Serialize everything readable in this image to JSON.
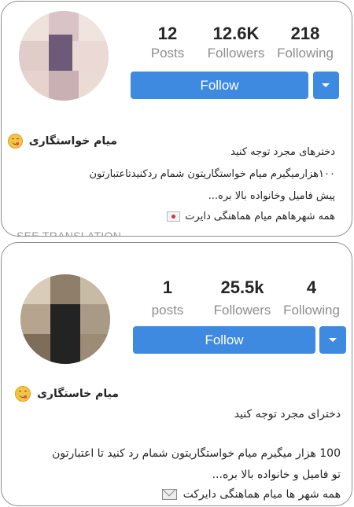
{
  "profile1": {
    "stats": {
      "posts_value": "12",
      "posts_label": "Posts",
      "followers_value": "12.6K",
      "followers_label": "Followers",
      "following_value": "218",
      "following_label": "Following"
    },
    "follow_label": "Follow",
    "name": "میام خواستگاری",
    "bio": [
      "دخترهای مجرد توجه کنید",
      "۱۰۰هزارمیگیرم میام خواستگاریتون شمام ردکنیدتاعتبارتون",
      "پیش فامیل وخانواده بالا بره...",
      "همه شهرهاهم میام هماهنگی دایرت"
    ],
    "see_translation": "SEE TRANSLATION"
  },
  "profile2": {
    "stats": {
      "posts_value": "1",
      "posts_label": "posts",
      "followers_value": "25.5k",
      "followers_label": "Followers",
      "following_value": "4",
      "following_label": "Following"
    },
    "follow_label": "Follow",
    "name": "میام خاستگاری",
    "bio": [
      "دخترای مجرد توجه کنید",
      "100 هزار میگیرم میام خواستگاریتون شمام رد کنید تا اعتبارتون",
      "تو فامیل و خانواده بالا بره...",
      "همه شهر ها میام هماهنگی دایرکت"
    ]
  },
  "colors": {
    "follow_blue": "#3d8ae0",
    "label_gray": "#8e8e8e"
  },
  "icons": {
    "emoji": "yum-face-emoji",
    "dropdown": "caret-down-icon",
    "envelope": "envelope-emoji",
    "letter": "incoming-envelope-emoji"
  }
}
